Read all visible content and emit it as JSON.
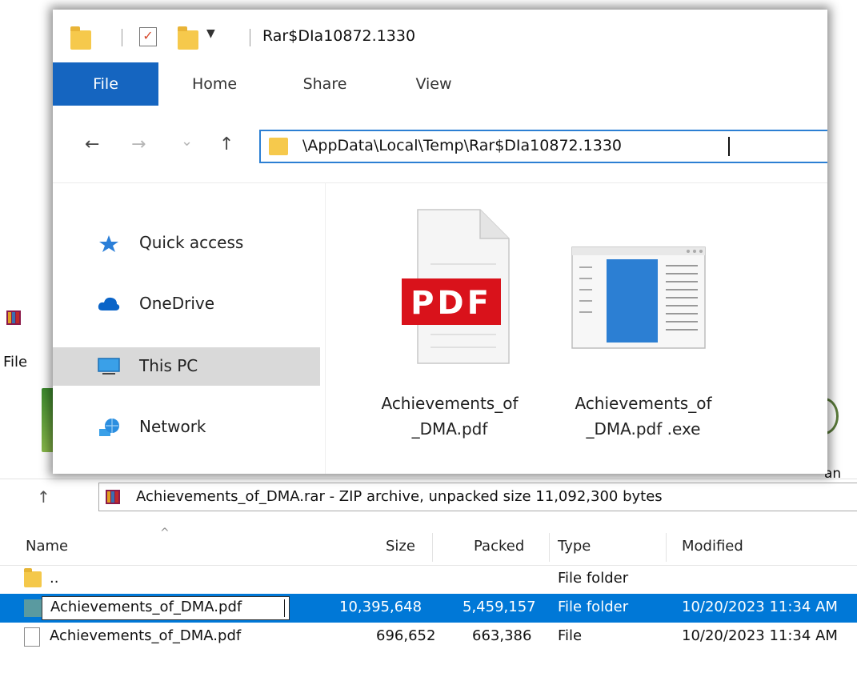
{
  "rar_window": {
    "menu_file": "File",
    "toolbar_partial_label": "an",
    "path_text": "Achievements_of_DMA.rar - ZIP archive, unpacked size 11,092,300 bytes",
    "columns": [
      "Name",
      "Size",
      "Packed",
      "Type",
      "Modified"
    ],
    "rows": [
      {
        "name": "..",
        "size": "",
        "packed": "",
        "type": "File folder",
        "modified": "",
        "icon": "folder-icon",
        "selected": false
      },
      {
        "name": "Achievements_of_DMA.pdf",
        "size": "10,395,648",
        "packed": "5,459,157",
        "type": "File folder",
        "modified": "10/20/2023 11:34 AM",
        "icon": "folder-icon",
        "selected": true,
        "renaming": true
      },
      {
        "name": "Achievements_of_DMA.pdf",
        "size": "696,652",
        "packed": "663,386",
        "type": "File",
        "modified": "10/20/2023 11:34 AM",
        "icon": "file-icon",
        "selected": false
      }
    ]
  },
  "explorer": {
    "title": "Rar$DIa10872.1330",
    "tabs": [
      {
        "label": "File",
        "active": true
      },
      {
        "label": "Home",
        "active": false
      },
      {
        "label": "Share",
        "active": false
      },
      {
        "label": "View",
        "active": false
      }
    ],
    "nav_buttons": {
      "back": "←",
      "forward": "→",
      "recent": "⌄",
      "up": "↑"
    },
    "address": "\\AppData\\Local\\Temp\\Rar$DIa10872.1330",
    "nav_items": [
      {
        "label": "Quick access",
        "icon": "star-icon",
        "selected": false
      },
      {
        "label": "OneDrive",
        "icon": "cloud-icon",
        "selected": false
      },
      {
        "label": "This PC",
        "icon": "monitor-icon",
        "selected": true
      },
      {
        "label": "Network",
        "icon": "network-icon",
        "selected": false
      }
    ],
    "files": [
      {
        "name_line1": "Achievements_of",
        "name_line2": "_DMA.pdf",
        "icon": "pdf-document-icon",
        "badge": "PDF"
      },
      {
        "name_line1": "Achievements_of",
        "name_line2": "_DMA.pdf .exe",
        "icon": "application-window-icon"
      }
    ]
  },
  "colors": {
    "accent_blue": "#0078d7",
    "ribbon_file_blue": "#1565c0",
    "pdf_red": "#d9121b",
    "folder_yellow": "#f6c94c"
  }
}
